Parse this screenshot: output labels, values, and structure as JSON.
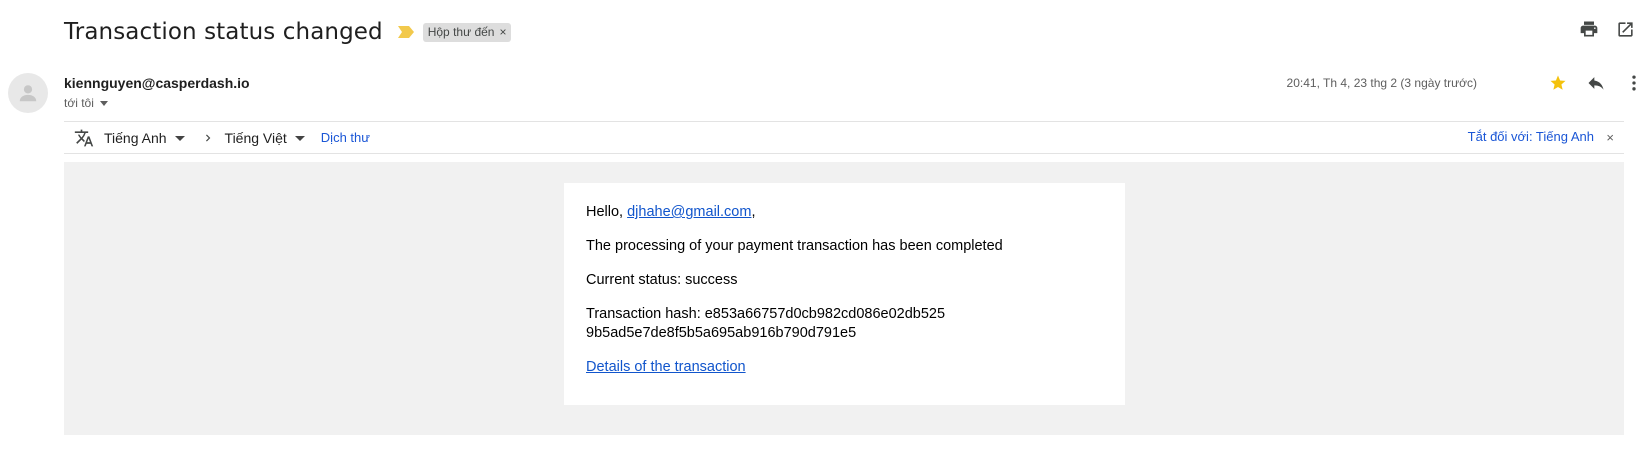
{
  "subject": "Transaction status changed",
  "label": {
    "text": "Hộp thư đến",
    "close": "×"
  },
  "header_actions": [
    "print-icon",
    "open-in-new-window-icon"
  ],
  "sender": {
    "email": "kiennguyen@casperdash.io",
    "recipient": "tới tôi",
    "date": "20:41, Th 4, 23 thg 2 (3 ngày trước)",
    "starred": true
  },
  "translate_bar": {
    "source_lang": "Tiếng Anh",
    "target_lang": "Tiếng Việt",
    "translate_link": "Dịch thư",
    "turn_off": "Tắt đối với: Tiếng Anh",
    "close": "×"
  },
  "email_body": {
    "greeting_prefix": "Hello,",
    "greeting_email": "djhahe@gmail.com",
    "greeting_suffix": ",",
    "line1": "The processing of your payment transaction has been completed",
    "status_line": "Current status: success",
    "hash_label": "Transaction hash: e853a66757d0cb982cd086e02db525",
    "hash_rest": "9b5ad5e7de8f5b5a695ab916b790d791e5",
    "details_link": "Details of the transaction"
  },
  "colors": {
    "link": "#1155cc",
    "star": "#f4c20d",
    "importance": "#f2c94c",
    "body_bg": "#f1f1f1"
  }
}
